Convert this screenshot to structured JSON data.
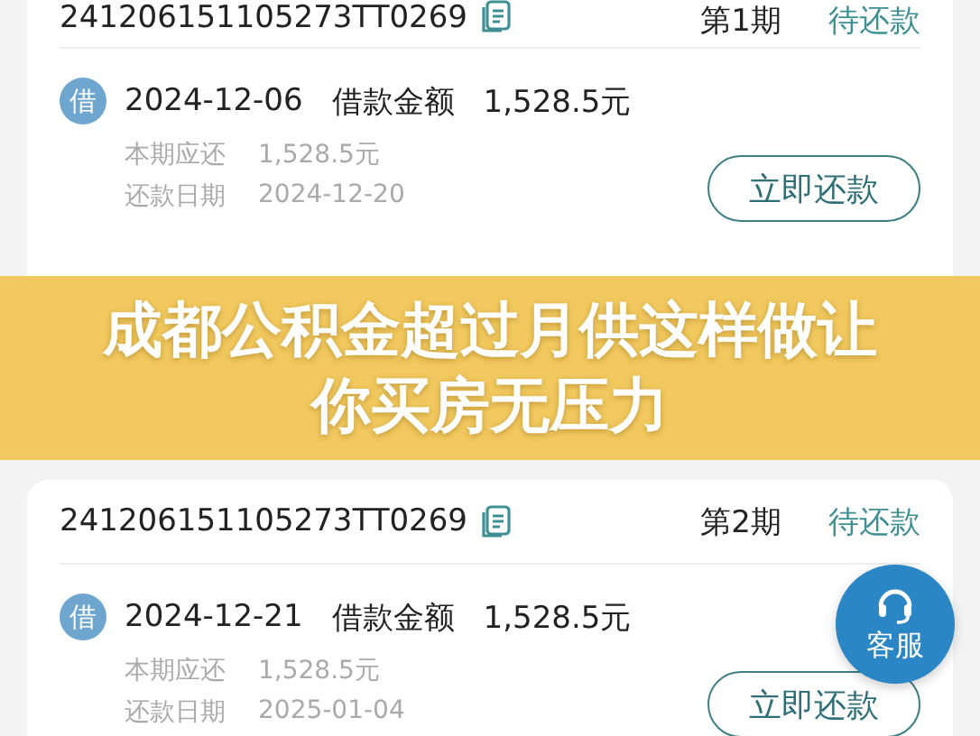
{
  "cards": [
    {
      "order_no": "241206151105273TT0269",
      "period": "第1期",
      "status": "待还款",
      "items": [
        {
          "badge": "借",
          "color": "#6fa6cf",
          "date": "2024-12-06",
          "type_label": "借款金额",
          "amount": "1,528.5元",
          "details": [
            {
              "label": "本期应还",
              "value": "1,528.5元"
            },
            {
              "label": "还款日期",
              "value": "2024-12-20"
            }
          ],
          "action": "立即还款"
        }
      ]
    },
    {
      "order_no": "241206151105273TT0269",
      "period": "第2期",
      "status": "待还款",
      "items": [
        {
          "badge": "借",
          "color": "#6fa6cf",
          "date": "2024-12-21",
          "type_label": "借款金额",
          "amount": "1,528.5元",
          "details": [
            {
              "label": "本期应还",
              "value": "1,528.5元"
            },
            {
              "label": "还款日期",
              "value": "2025-01-04"
            }
          ],
          "action": "立即还款"
        }
      ]
    }
  ],
  "headline": {
    "lines": [
      "成都公积金超过月供这样做让",
      "你买房无压力"
    ]
  },
  "support_button": {
    "label": "客服"
  }
}
